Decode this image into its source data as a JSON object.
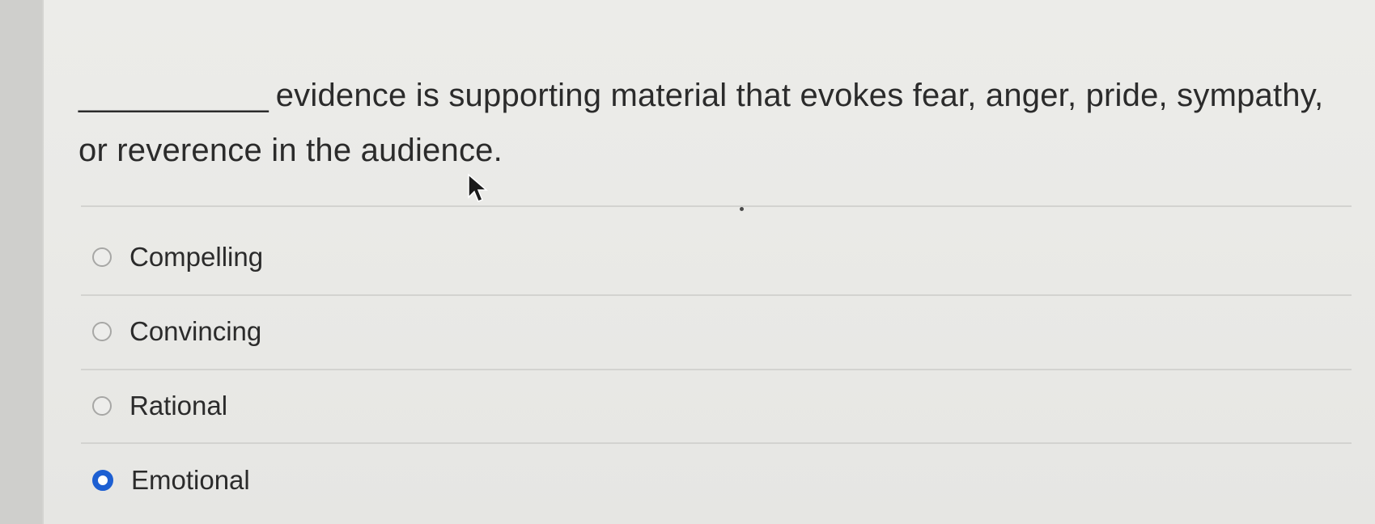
{
  "question": {
    "blank": "___________",
    "text": "evidence is supporting material that evokes fear, anger, pride, sympathy, or reverence in the audience."
  },
  "options": [
    {
      "label": "Compelling",
      "selected": false
    },
    {
      "label": "Convincing",
      "selected": false
    },
    {
      "label": "Rational",
      "selected": false
    },
    {
      "label": "Emotional",
      "selected": true
    }
  ],
  "colors": {
    "selected_radio": "#1d5fd2",
    "divider": "#d3d3d0",
    "text": "#2b2b2b"
  },
  "icons": {
    "cursor": "mouse-pointer-icon"
  }
}
